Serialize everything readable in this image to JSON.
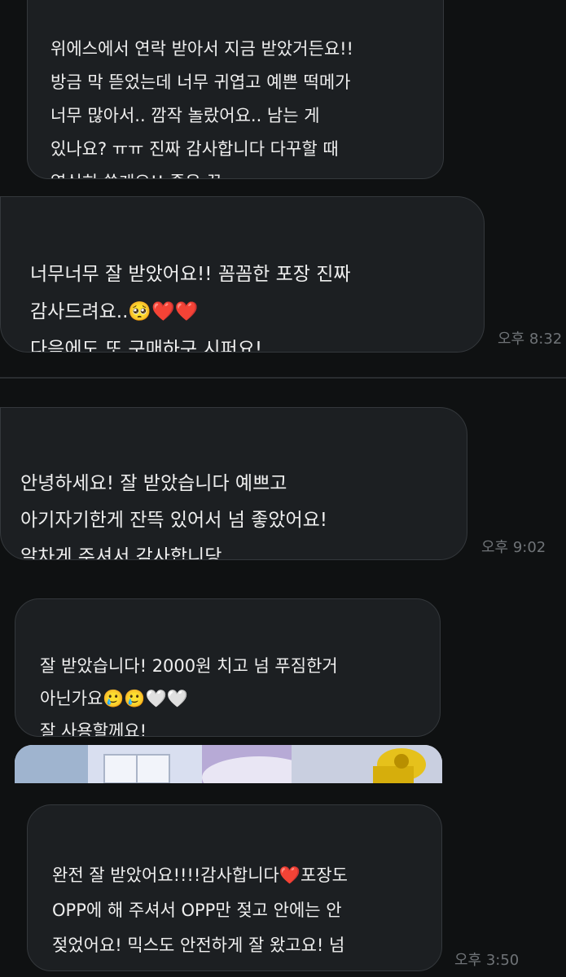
{
  "messages": [
    {
      "text": "위에스에서 연락 받아서 지금 받았거든요!!\n방금 막 뜯었는데 너무 귀엽고 예쁜 떡메가\n너무 많아서.. 깜작 놀랐어요.. 남는 게\n있나요? ㅠㅠ 진짜 감사합니다 다꾸할 때\n열심히 쓸게요!! 좋은 꿈\n꾸세요!!🫶❤️❤️😭❤️",
      "time": ""
    },
    {
      "text": "너무너무 잘 받았어요!! 꼼꼼한 포장 진짜\n감사드려요..🥺❤️❤️\n다음에도 또 구매하구 시퍼요!",
      "time": "오후 8:32"
    },
    {
      "text": "안녕하세요! 잘 받았습니다 예쁘고\n아기자기한게 잔뜩 있어서 넘 좋았어요!\n알차게 주셔서 감사합니당",
      "time": "오후 9:02"
    },
    {
      "text": "잘 받았습니다! 2000원 치고 넘 푸짐한거\n아닌가요🥲🥲🤍🤍\n잘 사용할께요!",
      "time": ""
    },
    {
      "text": "완전 잘 받았어요!!!!감사합니다❤️포장도\nOPP에 해 주셔서 OPP만 젖고 안에는 안\n젖었어요! 믹스도 안전하게 잘 왔고요! 넘\n감사합니다~",
      "time": "오후 3:50"
    }
  ],
  "colors": {
    "background": "#0f1112",
    "bubble": "#1c1f22",
    "bubble_border": "#34383c",
    "timestamp": "#6f7377"
  }
}
